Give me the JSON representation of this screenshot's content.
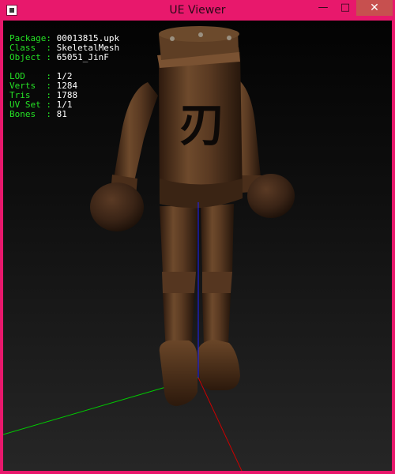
{
  "window": {
    "title": "UE Viewer",
    "controls": {
      "minimize_glyph": "—",
      "maximize_glyph": "□",
      "close_glyph": "✕"
    },
    "frame_color": "#e8186c"
  },
  "info_panel": {
    "key_color": "#25e125",
    "value_color": "#ffffff",
    "groups": [
      [
        {
          "key": "Package",
          "value": "00013815.upk"
        },
        {
          "key": "Class",
          "value": "SkeletalMesh"
        },
        {
          "key": "Object",
          "value": "65051_JinF"
        }
      ],
      [
        {
          "key": "LOD",
          "value": "1/2"
        },
        {
          "key": "Verts",
          "value": "1284"
        },
        {
          "key": "Tris",
          "value": "1788"
        },
        {
          "key": "UV Set",
          "value": "1/1"
        },
        {
          "key": "Bones",
          "value": "81"
        }
      ]
    ]
  },
  "scene": {
    "axis_colors": {
      "x": "#00cc00",
      "y": "#cc0000",
      "z": "#2020ff"
    },
    "body_glyph": "刃"
  }
}
